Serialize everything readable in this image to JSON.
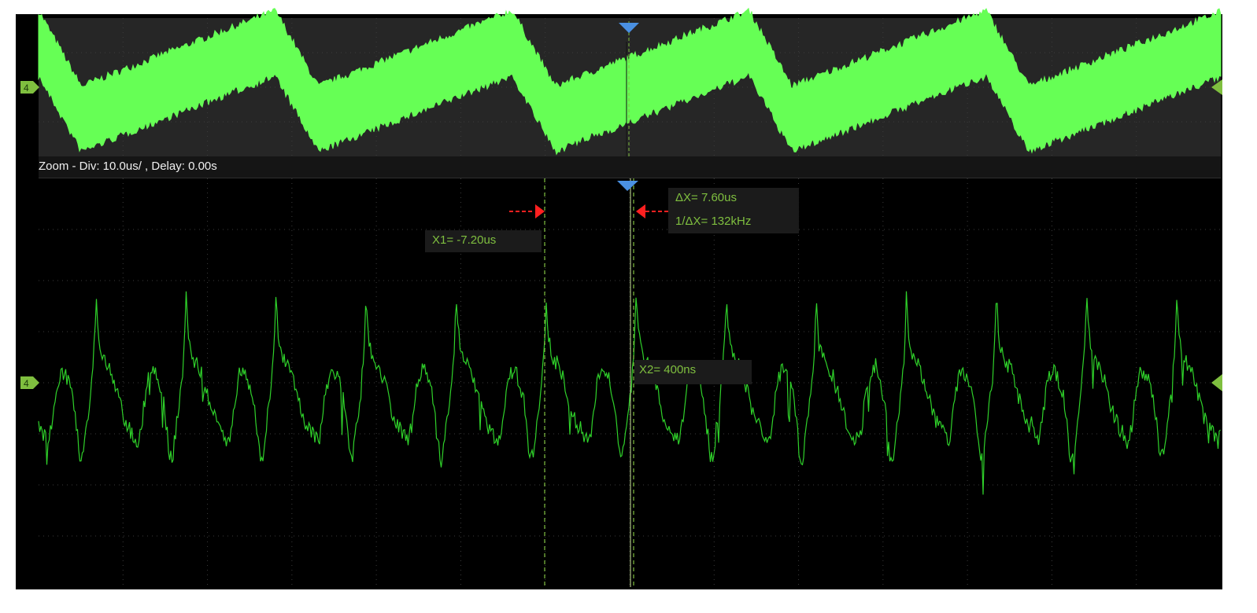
{
  "zoom_bar": {
    "text": "Zoom - Div: 10.0us/ ,  Delay: 0.00s"
  },
  "cursors": {
    "delta_x": "ΔX= 7.60us",
    "inverse_delta_x": "1/ΔX= 132kHz",
    "x1": "X1= -7.20us",
    "x2": "X2= 400ns"
  },
  "channel_marker": {
    "label": "4"
  },
  "colors": {
    "trace": "#66ff55",
    "zoom_trace": "#2fd12a",
    "cursor": "#7fbf3f",
    "trigger_marker": "#4a90e2",
    "arrow": "#ff2020",
    "grid": "#3c3c3c"
  }
}
